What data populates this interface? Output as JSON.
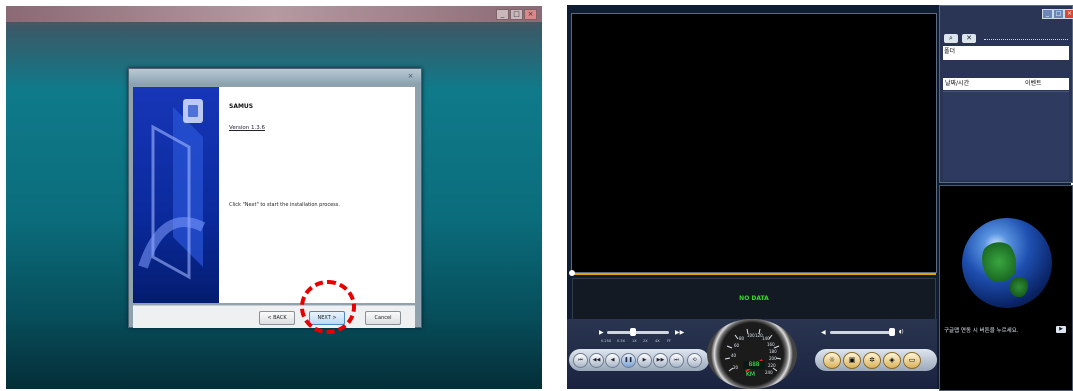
{
  "installer": {
    "product": "SAMUS",
    "version": "Version 1.3.6",
    "message": "Click \"Next\" to start the installation process.",
    "back_label": "< BACK",
    "next_label": "NEXT >",
    "cancel_label": "Cancel"
  },
  "player": {
    "status": "NO DATA",
    "speed_labels": [
      "0.25X",
      "0.5X",
      "1X",
      "2X",
      "4X",
      "FF"
    ],
    "gauge": {
      "ticks": [
        "20",
        "40",
        "60",
        "80",
        "100",
        "120",
        "140",
        "160",
        "180",
        "200",
        "220",
        "240"
      ],
      "digits": "888",
      "unit": "KM"
    },
    "right_panel": {
      "folder_label": "폴더",
      "col_datetime": "날짜/시간",
      "col_event": "이벤트"
    },
    "map_message": "구글맵 연동 시 버튼을 누르세요."
  },
  "colors": {
    "video_bg": "#000000",
    "status_green": "#33dd22",
    "timeline_orange": "#e3a400",
    "highlight_red": "#e60000"
  }
}
